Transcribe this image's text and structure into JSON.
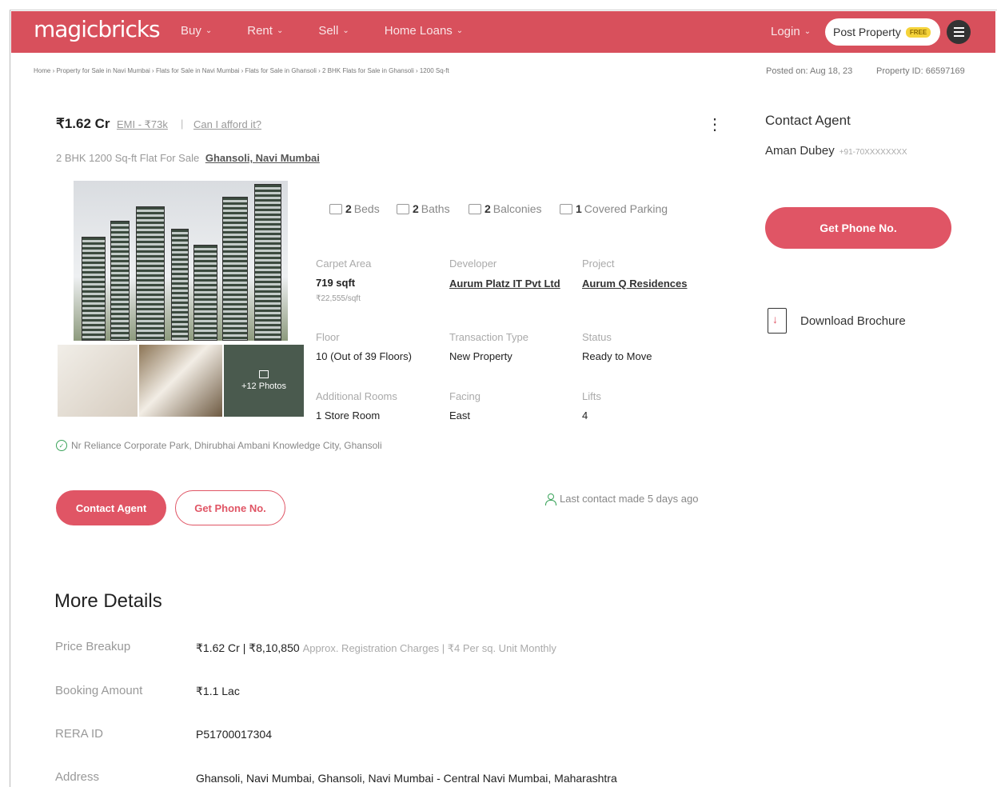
{
  "nav": {
    "logo": "magicbricks",
    "menu": [
      "Buy",
      "Rent",
      "Sell",
      "Home Loans"
    ],
    "login": "Login",
    "post_property": "Post Property",
    "free_badge": "FREE"
  },
  "breadcrumb": "Home › Property for Sale in Navi Mumbai › Flats for Sale in Navi Mumbai › Flats for Sale in Ghansoli › 2 BHK Flats for Sale in Ghansoli › 1200 Sq-ft",
  "posted_on": "Posted on: Aug 18, 23",
  "property_id": "Property ID: 66597169",
  "listing": {
    "price": "₹1.62 Cr",
    "emi": "EMI - ₹73k",
    "separator": "|",
    "afford": "Can I afford it?",
    "subtitle": "2 BHK 1200 Sq-ft Flat For Sale",
    "location": "Ghansoli, Navi Mumbai",
    "more_photos": "+12 Photos",
    "amenities": [
      {
        "count": "2",
        "label": "Beds"
      },
      {
        "count": "2",
        "label": "Baths"
      },
      {
        "count": "2",
        "label": "Balconies"
      },
      {
        "count": "1",
        "label": "Covered Parking"
      }
    ],
    "fields": {
      "carpet_area_label": "Carpet Area",
      "carpet_area": "719 sqft",
      "carpet_rate": "₹22,555/sqft",
      "developer_label": "Developer",
      "developer": "Aurum Platz IT Pvt Ltd",
      "project_label": "Project",
      "project": "Aurum Q Residences",
      "floor_label": "Floor",
      "floor": "10 (Out of 39 Floors)",
      "transaction_label": "Transaction Type",
      "transaction": "New Property",
      "status_label": "Status",
      "status": "Ready to Move",
      "additional_rooms_label": "Additional Rooms",
      "additional_rooms": "1 Store Room",
      "facing_label": "Facing",
      "facing": "East",
      "lifts_label": "Lifts",
      "lifts": "4"
    },
    "landmark": "Nr Reliance Corporate Park, Dhirubhai Ambani Knowledge City, Ghansoli",
    "contact_agent_btn": "Contact Agent",
    "get_phone_btn": "Get Phone No.",
    "last_contact": "Last contact made 5 days ago"
  },
  "agent_panel": {
    "heading": "Contact Agent",
    "agent_name": "Aman Dubey",
    "agent_phone": "+91-70XXXXXXXX",
    "get_phone_btn": "Get Phone No.",
    "brochure": "Download Brochure"
  },
  "more_details": {
    "heading": "More Details",
    "rows": [
      {
        "label": "Price Breakup",
        "value": "₹1.62 Cr | ₹8,10,850",
        "note": "Approx. Registration Charges | ₹4  Per sq. Unit Monthly"
      },
      {
        "label": "Booking Amount",
        "value": "₹1.1 Lac",
        "note": ""
      },
      {
        "label": "RERA ID",
        "value": "P51700017304",
        "note": ""
      },
      {
        "label": "Address",
        "value": "Ghansoli, Navi Mumbai, Ghansoli, Navi Mumbai - Central Navi Mumbai, Maharashtra",
        "note": ""
      }
    ]
  },
  "colors": {
    "brand": "#d8505c",
    "button": "#e05565",
    "check": "#3aa35a"
  }
}
